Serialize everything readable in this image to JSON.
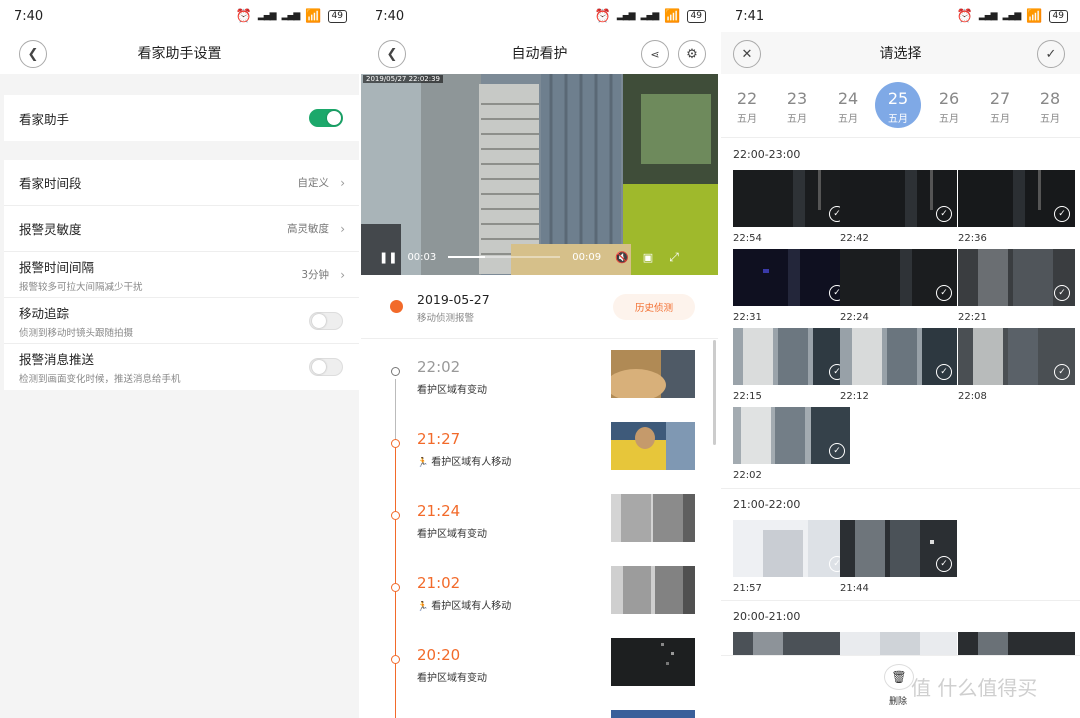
{
  "screen1": {
    "status": {
      "time": "7:40",
      "battery": "49"
    },
    "title": "看家助手设置",
    "assistant": {
      "label": "看家助手",
      "enabled": true
    },
    "rows": [
      {
        "label": "看家时间段",
        "value": "自定义"
      },
      {
        "label": "报警灵敏度",
        "value": "高灵敏度"
      },
      {
        "label": "报警时间间隔",
        "sub": "报警较多可拉大间隔减少干扰",
        "value": "3分钟"
      },
      {
        "label": "移动追踪",
        "sub": "侦测到移动时镜头跟随拍摄",
        "toggle": false
      },
      {
        "label": "报警消息推送",
        "sub": "检测到画面变化时候，推送消息给手机",
        "toggle": false
      }
    ]
  },
  "screen2": {
    "status": {
      "time": "7:40",
      "battery": "49"
    },
    "title": "自动看护",
    "video": {
      "timestamp": "2019/05/27  22:02:39",
      "current": "00:03",
      "duration": "00:09",
      "progress": 0.33
    },
    "alert": {
      "date": "2019-05-27",
      "desc": "移动侦测报警",
      "history_button": "历史侦测"
    },
    "events": [
      {
        "time": "22:02",
        "desc": "看护区域有变动",
        "person": false,
        "first": true
      },
      {
        "time": "21:27",
        "desc": "看护区域有人移动",
        "person": true
      },
      {
        "time": "21:24",
        "desc": "看护区域有变动",
        "person": false
      },
      {
        "time": "21:02",
        "desc": "看护区域有人移动",
        "person": true
      },
      {
        "time": "20:20",
        "desc": "看护区域有变动",
        "person": false
      }
    ]
  },
  "screen3": {
    "status": {
      "time": "7:41",
      "battery": "49"
    },
    "title": "请选择",
    "dates": [
      {
        "day": "22",
        "month": "五月"
      },
      {
        "day": "23",
        "month": "五月"
      },
      {
        "day": "24",
        "month": "五月"
      },
      {
        "day": "25",
        "month": "五月",
        "selected": true
      },
      {
        "day": "26",
        "month": "五月"
      },
      {
        "day": "27",
        "month": "五月"
      },
      {
        "day": "28",
        "month": "五月"
      }
    ],
    "sections": [
      {
        "header": "22:00-23:00",
        "clips": [
          "22:54",
          "22:42",
          "22:36",
          "22:31",
          "22:24",
          "22:21",
          "22:15",
          "22:12",
          "22:08",
          "22:02"
        ]
      },
      {
        "header": "21:00-22:00",
        "clips": [
          "21:57",
          "21:44"
        ]
      },
      {
        "header": "20:00-21:00",
        "clips": []
      }
    ],
    "delete_label": "删除"
  },
  "watermark": "值 什么值得买",
  "colors": {
    "accent_orange": "#f26a2a",
    "toggle_green": "#1ca86b",
    "date_selected": "#7fa9e6"
  }
}
